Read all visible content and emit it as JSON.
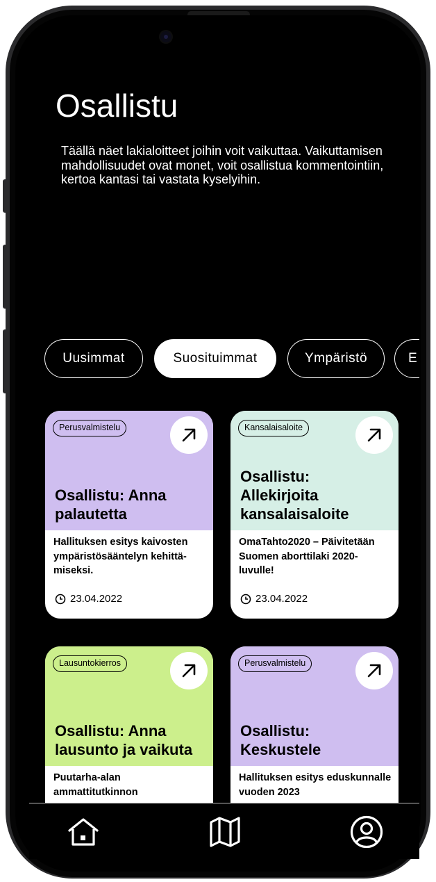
{
  "page": {
    "title": "Osallistu",
    "intro": "Täällä näet lakialoitteet joihin voit vaikuttaa. Vaikuttamisen mahdollisuudet ovat monet, voit osallistua kommentointiin, kertoa kantasi tai vastata kyselyihin."
  },
  "filters": [
    {
      "label": "Uusimmat",
      "active": false
    },
    {
      "label": "Suosituimmat",
      "active": true
    },
    {
      "label": "Ympäristö",
      "active": false
    },
    {
      "label": "E",
      "active": false
    }
  ],
  "cards": [
    {
      "tag": "Perusvalmistelu",
      "title": "Osallistu: Anna palautetta",
      "description": "Hallituksen esitys kaivosten ympäristösääntelyn kehittä-miseksi.",
      "date": "23.04.2022",
      "color": "#cfbef0"
    },
    {
      "tag": "Kansalaisaloite",
      "title": "Osallistu: Allekirjoita kansalaisaloite",
      "description": "OmaTahto2020 – Päivitetään Suomen aborttilaki 2020-luvulle!",
      "date": "23.04.2022",
      "color": "#d6efe6"
    },
    {
      "tag": "Lausuntokierros",
      "title": "Osallistu: Anna lausunto ja vaikuta",
      "description": "Puutarha-alan ammattitutkinnon",
      "color": "#ccef8c"
    },
    {
      "tag": "Perusvalmistelu",
      "title": "Osallistu: Keskustele",
      "description": "Hallituksen esitys eduskunnalle vuoden 2023",
      "color": "#cfbef0"
    }
  ],
  "icons": {
    "arrow": "arrow-up-right-icon",
    "clock": "clock-icon",
    "home": "home-icon",
    "map": "map-icon",
    "profile": "profile-icon"
  },
  "colors": {
    "background": "#000000",
    "chip_active_bg": "#ffffff"
  }
}
